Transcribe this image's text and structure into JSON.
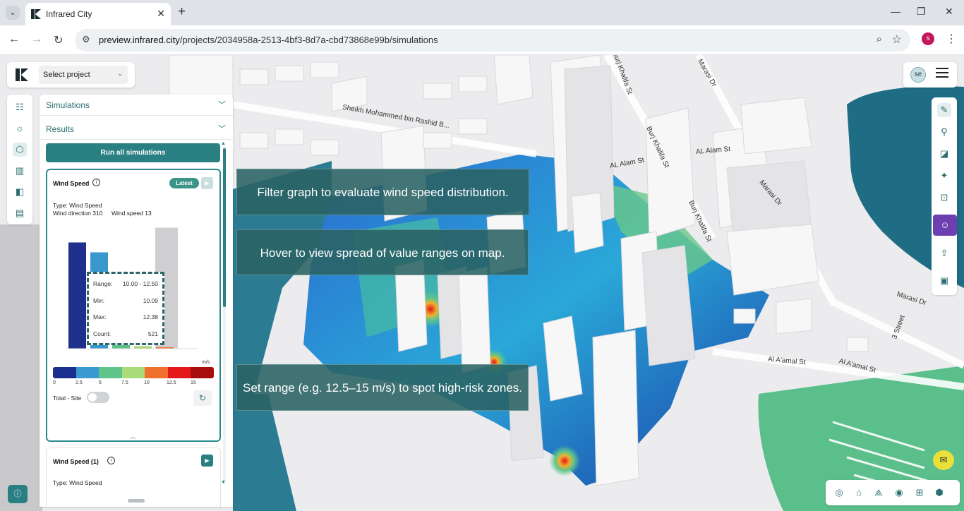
{
  "browser": {
    "tab_title": "Infrared City",
    "url_domain": "preview.infrared.city",
    "url_path": "/projects/2034958a-2513-4bf3-8d7a-cbd73868e99b/simulations",
    "profile_initial": "s",
    "profile_color": "#c2185b"
  },
  "app": {
    "project_select": "Select project",
    "user_initials": "se",
    "accent": "#2a7f83",
    "ai_accent": "#6d3fb0"
  },
  "panel": {
    "simulations_label": "Simulations",
    "results_label": "Results",
    "run_all_label": "Run all simulations",
    "card1": {
      "title": "Wind Speed",
      "badge": "Latest",
      "type": "Type: Wind Speed",
      "wind_direction": "Wind direction 310",
      "wind_speed": "Wind speed 13",
      "tooltip": {
        "range_label": "Range:",
        "range_value": "10.00 - 12.50",
        "min_label": "Min:",
        "min_value": "10.09",
        "max_label": "Max:",
        "max_value": "12.38",
        "count_label": "Count:",
        "count_value": "521"
      },
      "legend_unit": "m/s",
      "legend_ticks": [
        "0",
        "2.5",
        "5",
        "7.5",
        "10",
        "12.5",
        "15"
      ],
      "legend_colors": [
        "#1a2f8f",
        "#3a9bd0",
        "#5fc48a",
        "#a8dc7a",
        "#f07030",
        "#e3181b",
        "#a80d0d"
      ],
      "total_site_label": "Total - Site"
    },
    "card2": {
      "title": "Wind Speed (1)",
      "type": "Type: Wind Speed"
    }
  },
  "histogram": {
    "bins": [
      "0-2.5",
      "2.5-5",
      "5-7.5",
      "7.5-10",
      "10-12.5",
      "12.5-15"
    ],
    "relative_heights": [
      0.86,
      0.78,
      0.09,
      0.02,
      0.01,
      0.0
    ],
    "colors": [
      "#1e2f8c",
      "#3897cc",
      "#5cbf88",
      "#a6d676",
      "#f07030",
      "#e3181b"
    ],
    "hover_bin_index": 4
  },
  "map": {
    "streets": [
      "Sheikh Mohammed bin Rashid B...",
      "Burj Khalifa St",
      "AL Alam St",
      "Marasi Dr",
      "Al A'amal St",
      "3 Street"
    ]
  },
  "overlays": {
    "filter_tip": "Filter graph to evaluate wind speed distribution.",
    "hover_tip": "Hover to view spread of value ranges on map.",
    "range_tip": "Set range (e.g. 12.5–15 m/s) to spot high-risk zones."
  }
}
